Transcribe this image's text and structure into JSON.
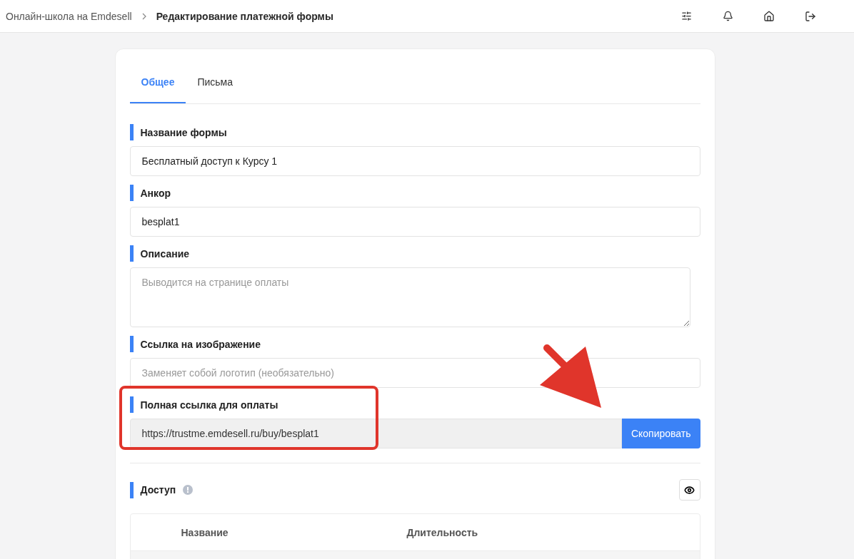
{
  "breadcrumbs": [
    {
      "label": "Онлайн-школа на Emdesell",
      "current": false
    },
    {
      "label": "Редактирование платежной формы",
      "current": true
    }
  ],
  "tabs": [
    {
      "label": "Общее",
      "selected": true
    },
    {
      "label": "Письма",
      "selected": false
    }
  ],
  "fields": [
    {
      "kind": "input",
      "label": "Название формы",
      "value": "Бесплатный доступ к Курсу 1"
    },
    {
      "kind": "input",
      "label": "Анкор",
      "value": "besplat1"
    },
    {
      "kind": "textarea",
      "label": "Описание",
      "placeholder": "Выводится на странице оплаты"
    },
    {
      "kind": "input",
      "label": "Ссылка на изображение",
      "placeholder": "Заменяет собой логотип (необязательно)"
    },
    {
      "kind": "copy",
      "label": "Полная ссылка для оплаты",
      "value": "https://trustme.emdesell.ru/buy/besplat1",
      "button": "Скопировать"
    }
  ],
  "access": {
    "title": "Доступ",
    "columns": [
      "Название",
      "Длительность"
    ]
  }
}
